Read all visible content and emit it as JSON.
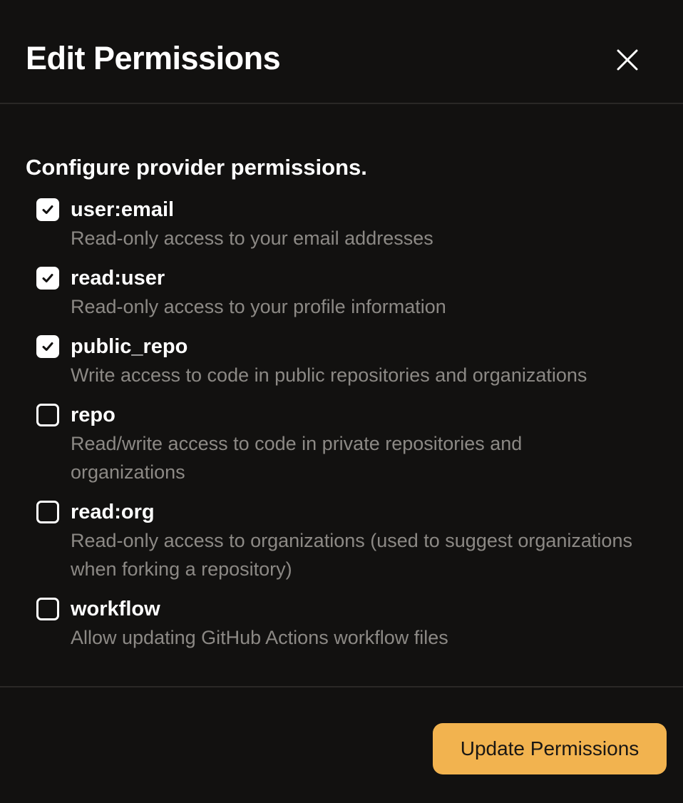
{
  "dialog": {
    "title": "Edit Permissions",
    "close_icon": "close-icon"
  },
  "section": {
    "title": "Configure provider permissions."
  },
  "permissions": [
    {
      "name": "user:email",
      "description": "Read-only access to your email addresses",
      "checked": true
    },
    {
      "name": "read:user",
      "description": "Read-only access to your profile information",
      "checked": true
    },
    {
      "name": "public_repo",
      "description": "Write access to code in public repositories and organizations",
      "checked": true
    },
    {
      "name": "repo",
      "description": "Read/write access to code in private repositories and organizations",
      "checked": false
    },
    {
      "name": "read:org",
      "description": "Read-only access to organizations (used to suggest organizations when forking a repository)",
      "checked": false
    },
    {
      "name": "workflow",
      "description": "Allow updating GitHub Actions workflow files",
      "checked": false
    }
  ],
  "footer": {
    "update_label": "Update Permissions"
  },
  "colors": {
    "background": "#121110",
    "divider": "#2a2826",
    "text_primary": "#ffffff",
    "text_secondary": "#8c8985",
    "accent": "#f2b34f"
  }
}
